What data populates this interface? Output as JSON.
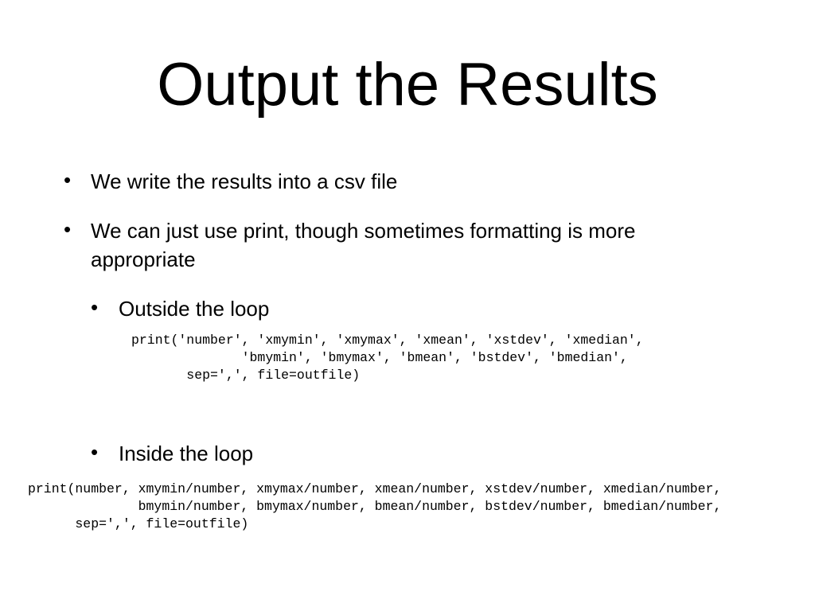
{
  "slide": {
    "title": "Output the Results",
    "bullet_glyph": "•",
    "bullets": [
      {
        "level": 1,
        "text": "We write the results into a csv file"
      },
      {
        "level": 1,
        "text": "We can just use print, though sometimes formatting is more appropriate"
      },
      {
        "level": 2,
        "text": "Outside the loop"
      },
      {
        "level": 2,
        "text": "Inside the loop"
      }
    ],
    "code_blocks": [
      {
        "label": "outside-loop",
        "code": "print('number', 'xmymin', 'xmymax', 'xmean', 'xstdev', 'xmedian',\n              'bmymin', 'bmymax', 'bmean', 'bstdev', 'bmedian',\n       sep=',', file=outfile)"
      },
      {
        "label": "inside-loop",
        "code": "print(number, xmymin/number, xmymax/number, xmean/number, xstdev/number, xmedian/number,\n              bmymin/number, bmymax/number, bmean/number, bstdev/number, bmedian/number,\n      sep=',', file=outfile)"
      }
    ]
  }
}
